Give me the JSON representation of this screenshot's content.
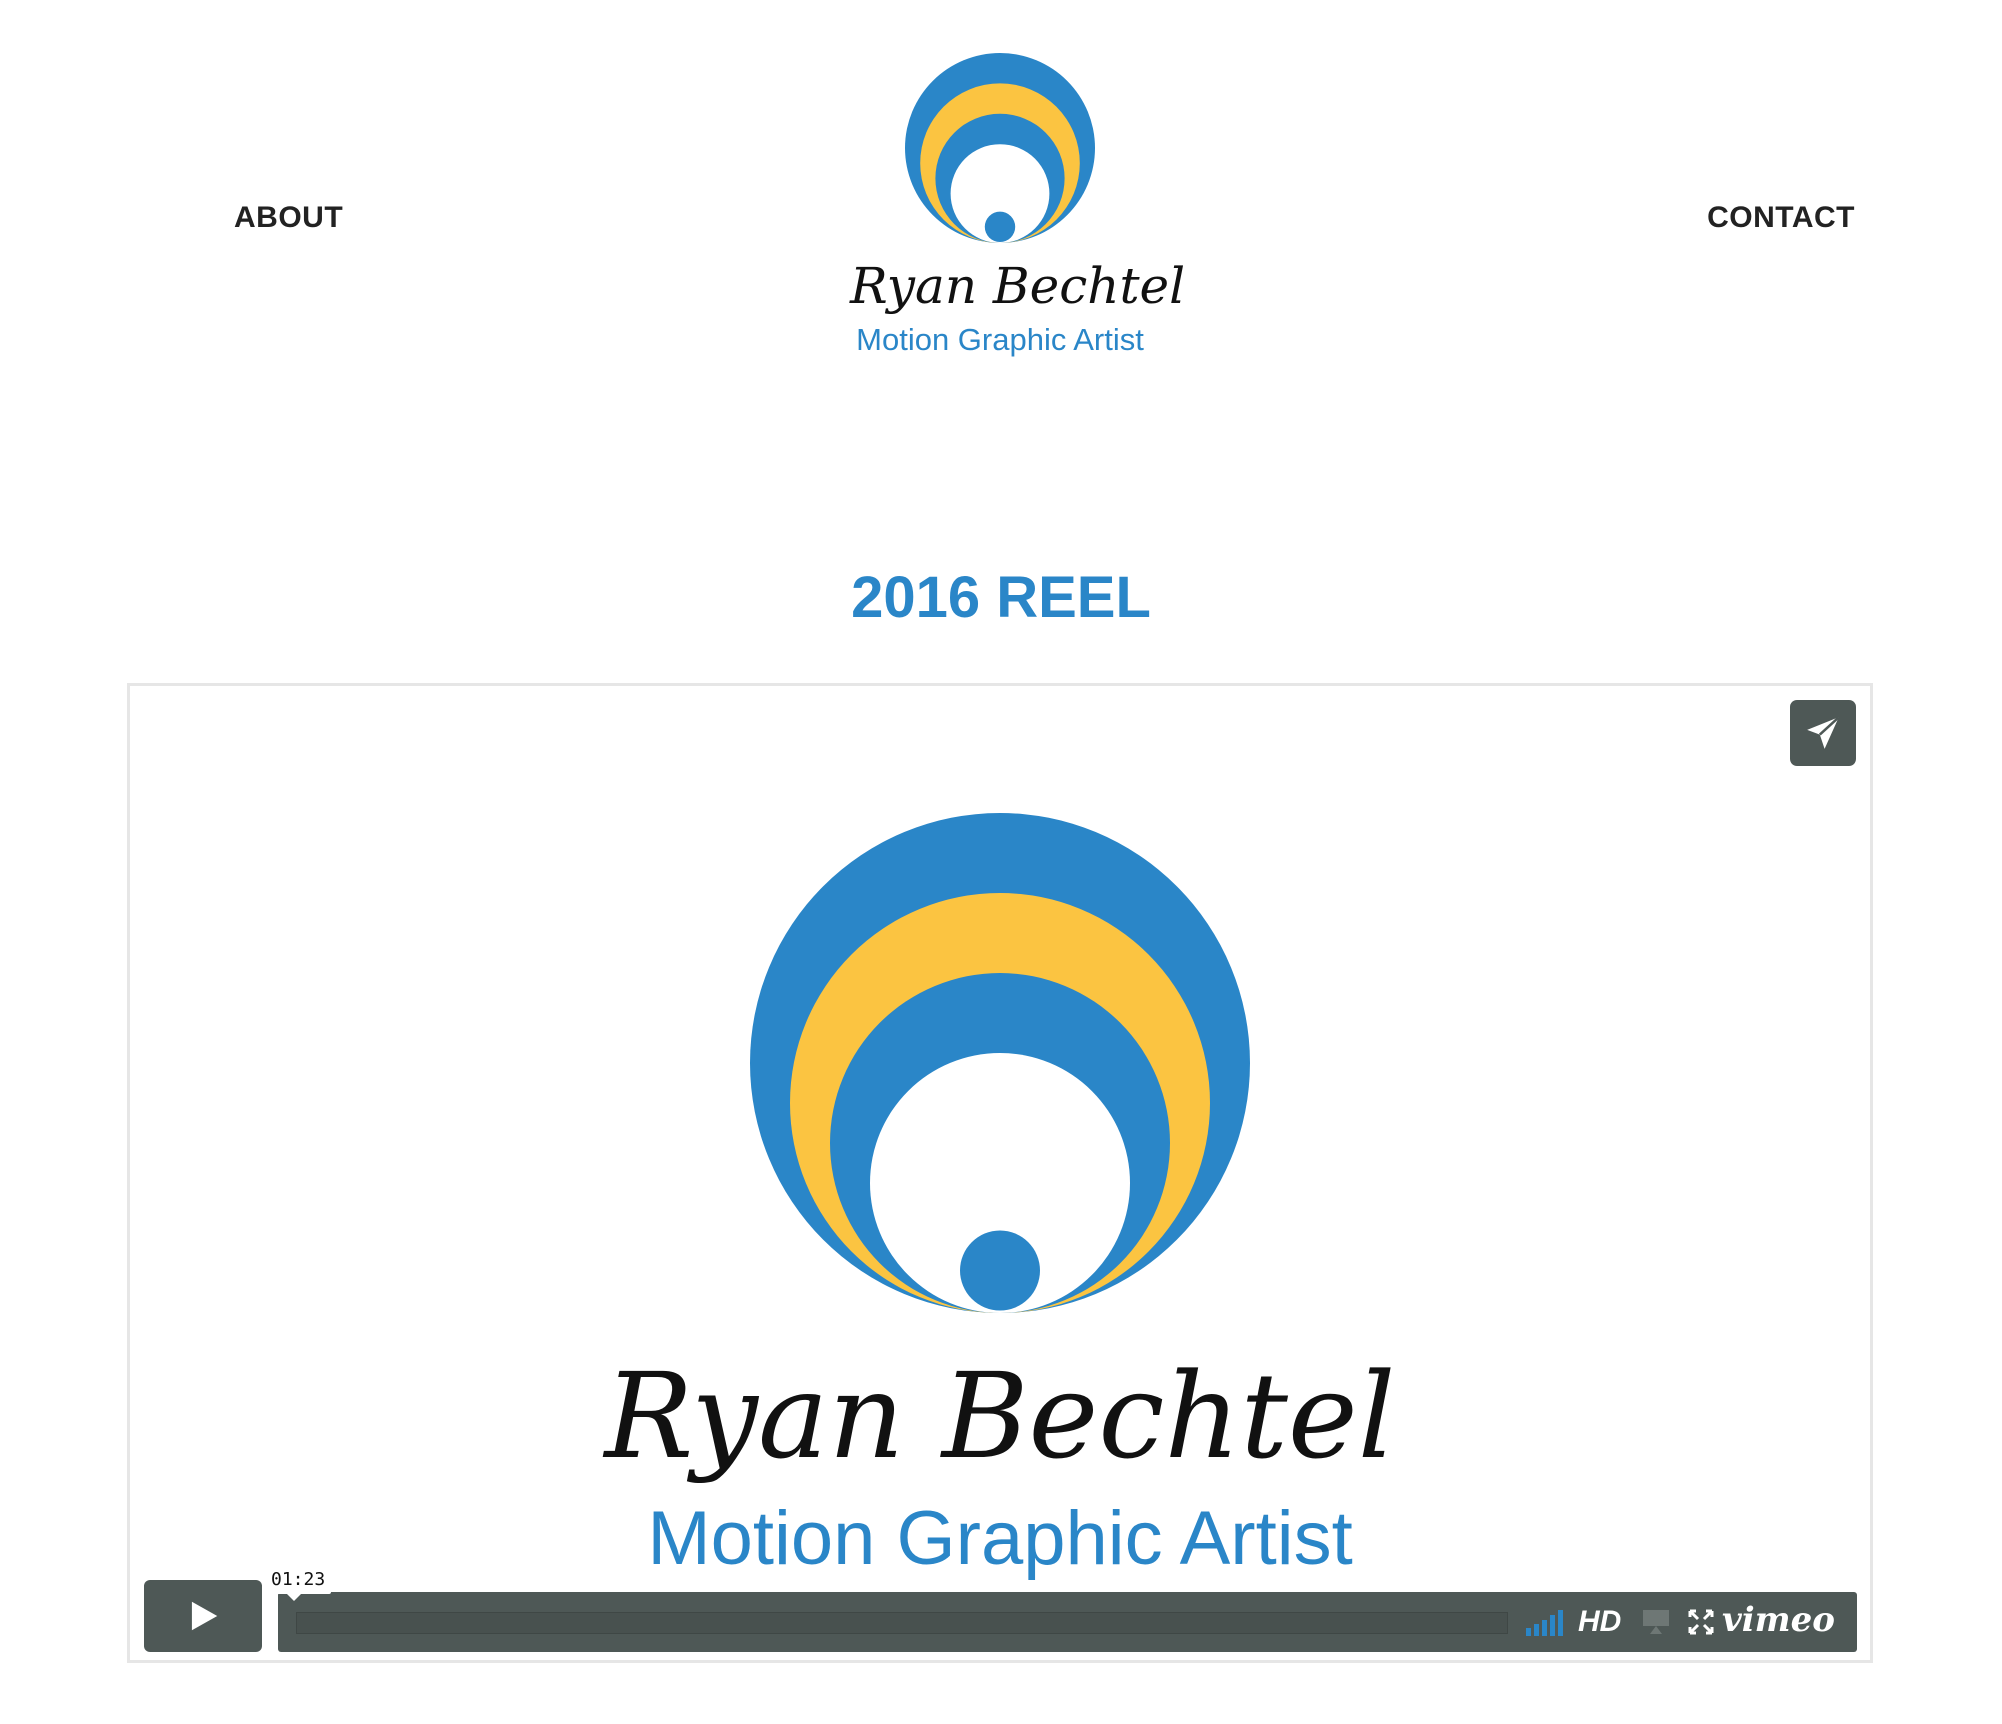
{
  "nav": {
    "about": "ABOUT",
    "contact": "CONTACT"
  },
  "logo": {
    "name": "Ryan Bechtel",
    "tagline": "Motion Graphic Artist",
    "icon": "concentric-arc-logo-mark",
    "colors": {
      "blue": "#2a86c8",
      "yellow": "#fbc441"
    }
  },
  "page": {
    "title": "2016 REEL"
  },
  "video": {
    "poster": {
      "name": "Ryan Bechtel",
      "tagline": "Motion Graphic Artist"
    },
    "duration": "01:23",
    "quality": "HD",
    "provider": "vimeo",
    "icons": {
      "share": "paper-plane-icon",
      "play": "play-icon",
      "volume": "volume-bars-icon",
      "airplay": "airplay-icon",
      "fullscreen": "fullscreen-icon"
    },
    "colors": {
      "controls": "#4e5856",
      "volume": "#2a86c8"
    }
  }
}
